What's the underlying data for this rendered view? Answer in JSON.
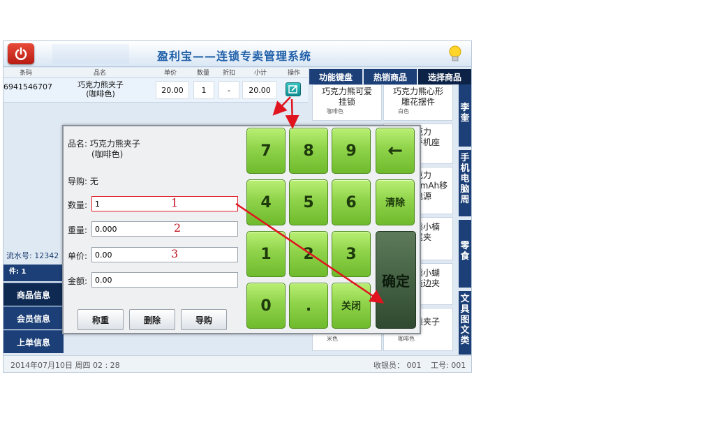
{
  "window": {
    "title": "盈利宝——连锁专卖管理系统"
  },
  "grid": {
    "headers": [
      "条码",
      "品名",
      "单价",
      "数量",
      "折扣",
      "小计",
      "操作"
    ],
    "row": {
      "barcode": "6941546707",
      "name_line1": "巧克力熊夹子",
      "name_line2": "(咖啡色)",
      "price": "20.00",
      "qty": "1",
      "discount": "-",
      "subtotal": "20.00"
    }
  },
  "tabs": [
    "功能键盘",
    "热销商品",
    "选择商品"
  ],
  "products": [
    {
      "name": "巧克力熊可爱\n挂锁",
      "color": "咖啡色"
    },
    {
      "name": "巧克力熊心形\n雕花摆件",
      "color": "白色"
    },
    {
      "name": "克力\n手机座",
      "color": ""
    },
    {
      "name": "克力\n0mAh移\n电源",
      "color": ""
    },
    {
      "name": "熊小楠\n尾夹",
      "color": ""
    },
    {
      "name": "熊小蝴\n装边夹",
      "color": ""
    },
    {
      "name": "熊夹子",
      "color": "咖啡色"
    },
    {
      "name": "",
      "color": "米色"
    }
  ],
  "categories": [
    "李奎",
    "手机电脑周",
    "零食",
    "文具图文类"
  ],
  "left_panel": {
    "serial": "流水号: 12342",
    "pieces": "件: 1",
    "buttons": [
      "商品信息",
      "会员信息",
      "上单信息"
    ]
  },
  "status": {
    "datetime": "2014年07月10日  周四 02 : 28",
    "cashier": "收银员： 001",
    "staff_no": "工号: 001"
  },
  "dialog": {
    "product_label": "品名: 巧克力熊夹子",
    "product_sub": "(咖啡色)",
    "guide_label": "导购: 无",
    "fields": [
      {
        "label": "数量:",
        "value": "1",
        "anno": "1"
      },
      {
        "label": "重量:",
        "value": "0.000",
        "anno": "2"
      },
      {
        "label": "单价:",
        "value": "0.00",
        "anno": "3"
      },
      {
        "label": "金额:",
        "value": "0.00",
        "anno": ""
      }
    ],
    "buttons": [
      "称重",
      "删除",
      "导购"
    ]
  },
  "keypad": {
    "keys": [
      "7",
      "8",
      "9",
      "←",
      "4",
      "5",
      "6",
      "清除",
      "1",
      "2",
      "3",
      "0",
      ".",
      "关闭"
    ],
    "confirm": "确定"
  }
}
